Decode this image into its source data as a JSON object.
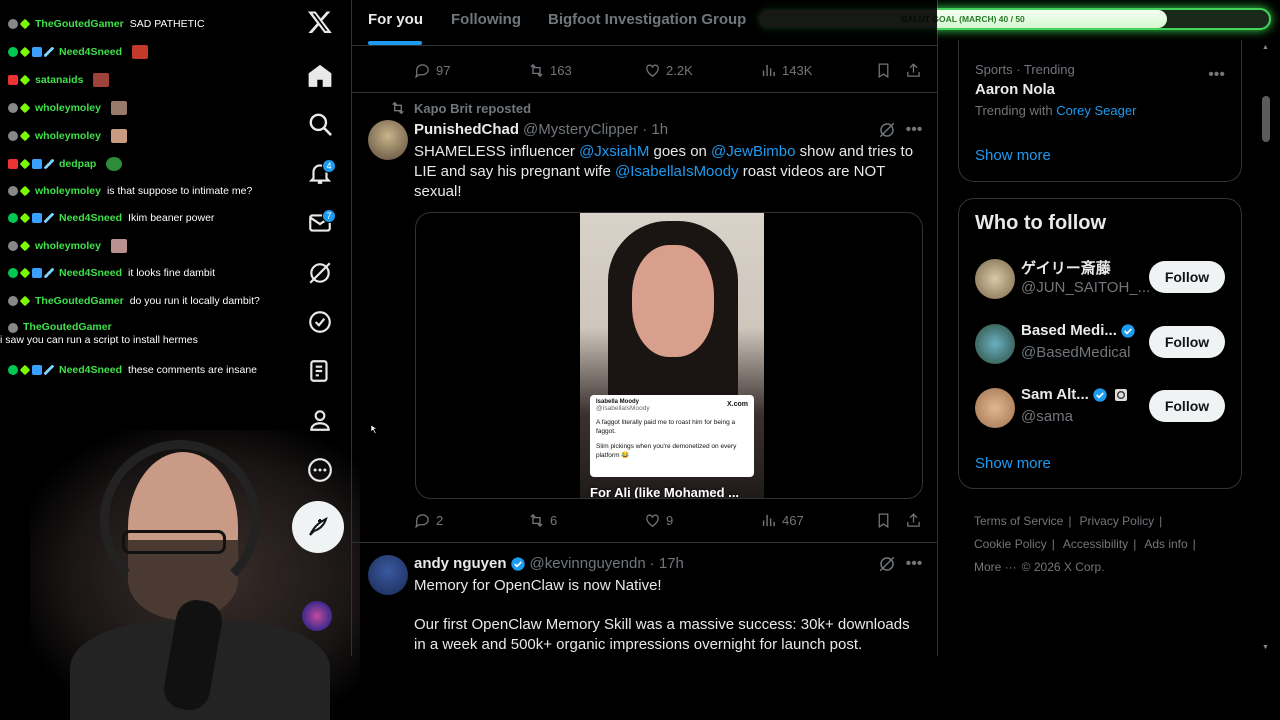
{
  "chat": {
    "messages": [
      {
        "user": "TheGoutedGamer",
        "text": "SAD PATHETIC"
      },
      {
        "user": "Need4Sneed",
        "text": ""
      },
      {
        "user": "satanaids",
        "text": ""
      },
      {
        "user": "wholeymoley",
        "text": ""
      },
      {
        "user": "wholeymoley",
        "text": ""
      },
      {
        "user": "dedpap",
        "text": ""
      },
      {
        "user": "wholeymoley",
        "text": "is that suppose to intimate me?"
      },
      {
        "user": "Need4Sneed",
        "text": "Ikim beaner power"
      },
      {
        "user": "wholeymoley",
        "text": ""
      },
      {
        "user": "Need4Sneed",
        "text": "it looks fine dambit"
      },
      {
        "user": "TheGoutedGamer",
        "text": "do you run it locally dambit?"
      },
      {
        "user": "TheGoutedGamer",
        "text": "i saw you can run a script to install hermes"
      },
      {
        "user": "Need4Sneed",
        "text": "these comments are insane"
      }
    ]
  },
  "nav": {
    "notifications_badge": "4",
    "messages_badge": "7"
  },
  "tabs": {
    "for_you": "For you",
    "following": "Following",
    "group": "Bigfoot Investigation Group"
  },
  "goal": {
    "label": "BALUT GOAL (MARCH) 40 / 50",
    "progress": 0.8
  },
  "post0": {
    "replies": "97",
    "reposts": "163",
    "likes": "2.2K",
    "views": "143K"
  },
  "post1": {
    "repost_label": "Kapo Brit reposted",
    "name": "PunishedChad",
    "handle": "@MysteryClipper",
    "time": "· 1h",
    "text_1": "SHAMELESS influencer ",
    "mention_1": "@JxsiahM",
    "text_2": " goes on ",
    "mention_2": "@JewBimbo",
    "text_3": " show and tries to LIE and say his pregnant wife ",
    "mention_3": "@IsabellaIsMoody",
    "text_4": " roast videos are NOT sexual!",
    "video_card_name": "Isabella Moody",
    "video_card_handle": "@IsabellaIsMoody",
    "video_card_site": "X.com",
    "video_card_text_1": "A faggot literally paid me to roast him for being a faggot.",
    "video_card_text_2": "Slim pickings when you're demonetized on every platform 😂",
    "video_caption": "For Ali (like Mohamed ...",
    "replies": "2",
    "reposts": "6",
    "likes": "9",
    "views": "467"
  },
  "post2": {
    "name": "andy nguyen",
    "handle": "@kevinnguyendn",
    "time": "· 17h",
    "text_1": "Memory for OpenClaw is now Native!",
    "text_2": "Our first OpenClaw Memory Skill was a massive success: 30k+ downloads in a week and 500k+ organic impressions overnight for launch post."
  },
  "trend": {
    "meta": "Sports · Trending",
    "title": "Aaron Nola",
    "with_label": "Trending with",
    "with_link": "Corey Seager",
    "show_more": "Show more"
  },
  "who_to_follow": {
    "title": "Who to follow",
    "follow_label": "Follow",
    "show_more": "Show more",
    "accounts": [
      {
        "name": "ゲイリー斎藤",
        "handle": "@JUN_SAITOH_..."
      },
      {
        "name": "Based Medi...",
        "handle": "@BasedMedical"
      },
      {
        "name": "Sam Alt...",
        "handle": "@sama"
      }
    ]
  },
  "footer": {
    "terms": "Terms of Service",
    "privacy": "Privacy Policy",
    "cookie": "Cookie Policy",
    "accessibility": "Accessibility",
    "ads": "Ads info",
    "more": "More ···",
    "copyright": "© 2026 X Corp."
  },
  "colors": {
    "accent": "#1d9bf0",
    "chat_username": "#3fe04a",
    "goal_glow": "#36e04e"
  }
}
